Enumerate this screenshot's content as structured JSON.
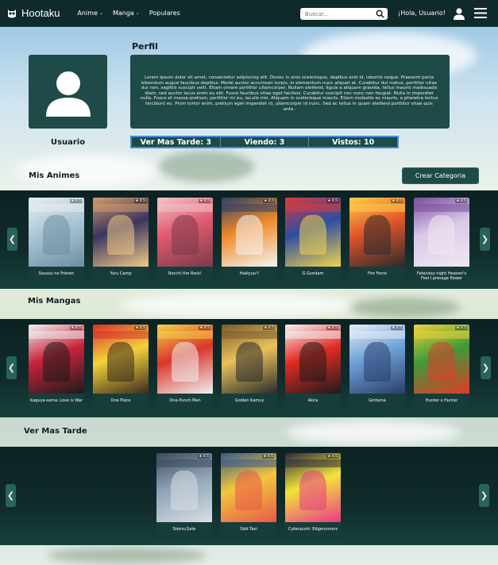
{
  "navbar": {
    "brand": "Hootaku",
    "menu": [
      {
        "label": "Anime",
        "dropdown": true
      },
      {
        "label": "Manga",
        "dropdown": true
      },
      {
        "label": "Populares",
        "dropdown": false
      }
    ],
    "search_placeholder": "Buscar...",
    "greeting": "¡Hola, Usuario!"
  },
  "profile": {
    "title": "Perfil",
    "username": "Usuario",
    "bio": "Lorem ipsum dolor sit amet, consectetur adipiscing elit. Donec in eros scelerisque, dapibus erat id, lobortis neque. Praesent porta bibendum augue faucibus dapibus. Morbi auctor accumsan turpis, in elementum nunc aliquet at. Curabitur dui metus, porttitor vitae dui non, sagittis suscipit velit. Etiam ornare porttitor ullamcorper. Nullam eleifend, ligula a aliquam gravida, tellus mauris malesuada diam, sed auctor lacus enim eu elit. Fusce faucibus vitae eget facilisis. Curabitur suscipit nec nunc non feugiat. Nulla in imperdiet nulla. Fusce et massa pretium, porttitor mi eu, iaculis nisi. Aliquam in scelerisque mauris. Etiam molestie ex mauris, a pharetra lectus tincidunt eu. Proin tortor enim, pretium eget imperdiet id, ullamcorper id nunc. Sed ac tellus in quam eleifend porttitor vitae quis ante.",
    "stats": {
      "ver_mas_tarde": "Ver Mas Tarde: 3",
      "viendo": "Viendo: 3",
      "vistos": "Vistos: 10"
    }
  },
  "sections": {
    "animes_title": "Mis Animes",
    "crear_categoria": "Crear Categoria",
    "mangas_title": "Mis Mangas",
    "ver_mas_tarde_title": "Ver Mas Tarde"
  },
  "animes": [
    {
      "title": "Sousou no Frieren",
      "rating": "★ 4.5",
      "colors": [
        "#a9c7d6",
        "#e9eef0",
        "#6f8fa3"
      ]
    },
    {
      "title": "Yuru Camp",
      "rating": "★ 4.5",
      "colors": [
        "#3a3560",
        "#d39b6a",
        "#f0c987"
      ]
    },
    {
      "title": "Bocchi the Rock!",
      "rating": "★ 4.5",
      "colors": [
        "#e05a6f",
        "#f4c4c9",
        "#7a3a4a"
      ]
    },
    {
      "title": "Haikyuu!!",
      "rating": "★ 4.5",
      "colors": [
        "#f08a2a",
        "#2c3e66",
        "#f5f5f5"
      ]
    },
    {
      "title": "G Gundam",
      "rating": "★ 4.5",
      "colors": [
        "#2d4da3",
        "#d93b3b",
        "#f2d44c"
      ]
    },
    {
      "title": "Fire Force",
      "rating": "★ 4.5",
      "colors": [
        "#e2552a",
        "#ffcf4a",
        "#2a2a2a"
      ]
    },
    {
      "title": "Fate/stay night Heaven's Feel I presage flower",
      "rating": "★ 4.5",
      "colors": [
        "#d8c8e8",
        "#7a4b9c",
        "#f1e7f3"
      ]
    }
  ],
  "mangas": [
    {
      "title": "Kaguya-sama: Love is War",
      "rating": "★ 4.5",
      "colors": [
        "#c8233a",
        "#f2f2f2",
        "#1b1b1b"
      ]
    },
    {
      "title": "One Piece",
      "rating": "★ 4.5",
      "colors": [
        "#f3d23c",
        "#d6322b",
        "#3a2a1e"
      ]
    },
    {
      "title": "One-Punch Man",
      "rating": "★ 4.5",
      "colors": [
        "#d9372b",
        "#f5d24a",
        "#f0f0f0"
      ]
    },
    {
      "title": "Golden Kamuy",
      "rating": "★ 4.5",
      "colors": [
        "#e8c25a",
        "#7a5a2e",
        "#2a2a2a"
      ]
    },
    {
      "title": "Akira",
      "rating": "★ 4.5",
      "colors": [
        "#e32b22",
        "#f5f5f5",
        "#1b1b1b"
      ]
    },
    {
      "title": "Gintama",
      "rating": "★ 4.5",
      "colors": [
        "#6ea0d8",
        "#e5eef8",
        "#2a3e6a"
      ]
    },
    {
      "title": "Hunter x Hunter",
      "rating": "★ 4.5",
      "colors": [
        "#3e9a3a",
        "#f2d23a",
        "#e23a2a"
      ]
    }
  ],
  "later": [
    {
      "title": "Steins;Gate",
      "rating": "★ 4.5",
      "colors": [
        "#8fa3b5",
        "#3a4a5e",
        "#d9dfe6"
      ]
    },
    {
      "title": "Odd Taxi",
      "rating": "★ 4.5",
      "colors": [
        "#f2c63c",
        "#3a5a8a",
        "#e85a4a"
      ]
    },
    {
      "title": "Cyberpunk: Edgerunners",
      "rating": "★ 4.5",
      "colors": [
        "#f2e43a",
        "#2a2a3a",
        "#e83a8a"
      ]
    }
  ],
  "icons": {
    "logo": "owl-icon",
    "search": "search-icon",
    "user": "user-icon",
    "menu": "hamburger-menu-icon",
    "prev": "chevron-left-icon",
    "next": "chevron-right-icon",
    "avatar": "avatar-placeholder-icon"
  },
  "colors": {
    "navbar": "#0f2a2b",
    "panel": "#1e4a47",
    "accent_border": "#3e8ee0"
  }
}
